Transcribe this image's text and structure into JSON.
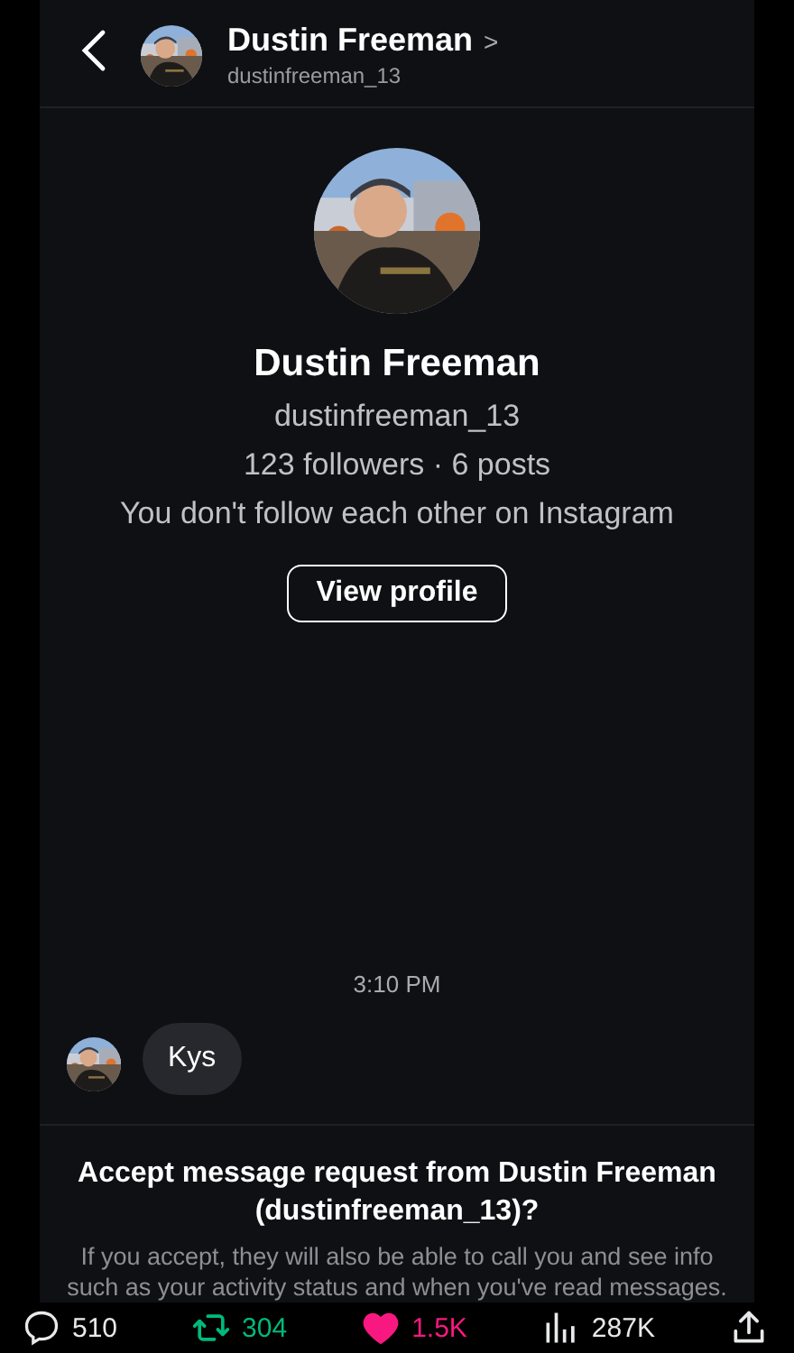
{
  "header": {
    "name": "Dustin Freeman",
    "chevron": ">",
    "username": "dustinfreeman_13"
  },
  "profile": {
    "name": "Dustin Freeman",
    "username": "dustinfreeman_13",
    "stats": "123 followers · 6 posts",
    "relation": "You don't follow each other on Instagram",
    "button": "View profile"
  },
  "timestamp": "3:10 PM",
  "messages": [
    {
      "text": "Kys"
    }
  ],
  "request": {
    "title": "Accept message request from Dustin Freeman (dustinfreeman_13)?",
    "body": "If you accept, they will also be able to call you and see info such as your activity status and when you've read messages."
  },
  "actions": [
    {
      "kind": "reply",
      "count": "510",
      "active": false
    },
    {
      "kind": "repost",
      "count": "304",
      "active": true
    },
    {
      "kind": "like",
      "count": "1.5K",
      "active": true
    },
    {
      "kind": "views",
      "count": "287K",
      "active": false
    },
    {
      "kind": "share",
      "active": false
    }
  ]
}
